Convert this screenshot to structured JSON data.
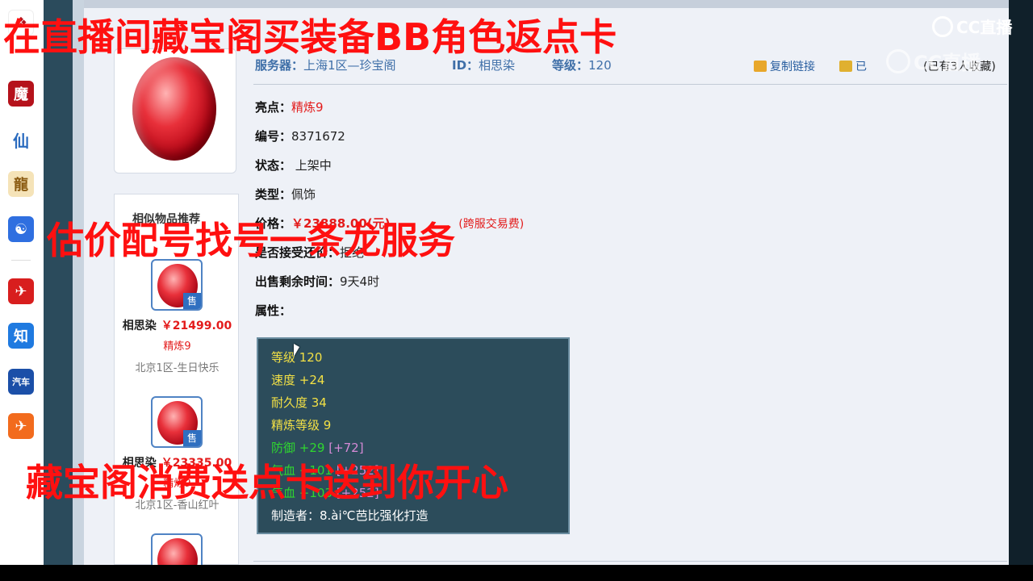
{
  "overlay": {
    "top_banner": "在直播间藏宝阁买装备BB角色返点卡",
    "mid_banner": "估价配号找号一条龙服务",
    "bottom_banner": "藏宝阁消费送点卡送到你开心",
    "watermark_main": "CC直播",
    "watermark_secondary": "CC直播"
  },
  "taskbar": {
    "icons": [
      {
        "name": "game-icon",
        "glyph": "魔",
        "color": "#b5121b"
      },
      {
        "name": "xian-icon",
        "glyph": "仙",
        "color": "#2a6bbf"
      },
      {
        "name": "long-icon",
        "glyph": "龍",
        "color": "#c08a18"
      },
      {
        "name": "baidu-icon",
        "glyph": "☯",
        "color": "#2f6fe0"
      },
      {
        "name": "red-app-icon",
        "glyph": "✈",
        "color": "#d81e1e"
      },
      {
        "name": "zhihu-icon",
        "glyph": "知",
        "color": "#1f7ae0"
      },
      {
        "name": "car-icon",
        "glyph": "汽车",
        "color": "#1b4fa8"
      },
      {
        "name": "orange-app-icon",
        "glyph": "✈",
        "color": "#f26b1d"
      }
    ]
  },
  "header": {
    "server_label": "服务器：",
    "server_value": "上海1区—珍宝阁",
    "id_label": "ID：",
    "id_value": "相思染",
    "level_label": "等级：",
    "level_value": "120",
    "copy_link": "复制链接",
    "fav_link": "已",
    "fav_count": "(已有3人收藏)"
  },
  "item": {
    "highlight_label": "亮点：",
    "highlight_value": "精炼9",
    "number_label": "编号：",
    "number_value": "8371672",
    "status_label": "状态：",
    "status_value": "上架中",
    "type_label": "类型：",
    "type_value": "佩饰",
    "price_label": "价格：",
    "price_value": "￥23888.00(元)",
    "fee_value": "(跨服交易费)",
    "bargain_label": "是否接受还价：",
    "bargain_value": "拒绝",
    "time_label": "出售剩余时间：",
    "time_value": "9天4时",
    "attr_label": "属性："
  },
  "attributes": {
    "level": "等级 120",
    "speed": "速度 +24",
    "durability": "耐久度 34",
    "refine": "精炼等级 9",
    "defense": "防御 +29",
    "defense_bonus": "[+72]",
    "hp1": "气血 +101",
    "hp1_bonus": "[+252]",
    "hp2": "气血 +103",
    "hp2_bonus": "[+252]",
    "maker": "制造者：8.ài℃芭比强化打造"
  },
  "recommend": {
    "title": "相似物品推荐",
    "sell_tag": "售",
    "items": [
      {
        "name": "相思染",
        "price": "￥21499.00",
        "tag": "精炼9",
        "server": "北京1区-生日快乐"
      },
      {
        "name": "相思染",
        "price": "￥23335.00",
        "tag": "精炼9",
        "server": "北京1区-香山红叶"
      }
    ]
  }
}
